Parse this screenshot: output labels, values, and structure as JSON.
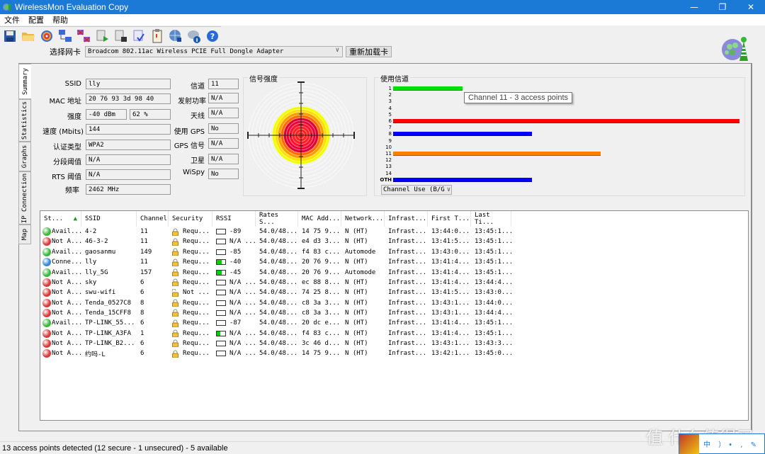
{
  "window": {
    "title": "WirelessMon Evaluation Copy",
    "controls": [
      "minimize",
      "restore",
      "close"
    ]
  },
  "menu": [
    "文件",
    "配置",
    "帮助"
  ],
  "toolbar": {
    "icons": [
      "save-icon",
      "open-folder-icon",
      "target-icon",
      "connect-icon",
      "disconnect-icon",
      "log-start-icon",
      "log-stop-icon",
      "report-icon",
      "clipboard-icon",
      "web-icon",
      "info-icon",
      "help-icon"
    ]
  },
  "adapter": {
    "label": "选择网卡",
    "selected": "Broadcom 802.11ac Wireless PCIE Full Dongle Adapter",
    "reload_label": "重新加载卡"
  },
  "tabs": [
    "Summary",
    "Statistics",
    "Graphs",
    "IP Connection",
    "Map"
  ],
  "active_tab": "Summary",
  "summary": {
    "left": [
      {
        "label": "SSID",
        "value": "lly"
      },
      {
        "label": "MAC 地址",
        "value": "20 76 93 3d 98 40"
      },
      {
        "label": "强度",
        "value": "-40 dBm",
        "value2": "62 %"
      },
      {
        "label": "速度 (Mbits)",
        "value": "144"
      },
      {
        "label": "认证类型",
        "value": "WPA2"
      },
      {
        "label": "分段阈值",
        "value": "N/A"
      },
      {
        "label": "RTS 阈值",
        "value": "N/A"
      },
      {
        "label": "频率",
        "value": "2462 MHz"
      }
    ],
    "right": [
      {
        "label": "信道",
        "value": "11"
      },
      {
        "label": "发射功率",
        "value": "N/A"
      },
      {
        "label": "天线",
        "value": "N/A"
      },
      {
        "label": "使用 GPS",
        "value": "No"
      },
      {
        "label": "GPS 信号",
        "value": "N/A"
      },
      {
        "label": "卫星",
        "value": "N/A"
      },
      {
        "label": "WiSpy",
        "value": "No"
      }
    ]
  },
  "signal": {
    "title": "信号强度",
    "percent": 62
  },
  "channel_use": {
    "title": "使用信道",
    "channels": [
      {
        "label": "1",
        "count": 1,
        "color": "#00e000"
      },
      {
        "label": "2",
        "count": 0,
        "color": ""
      },
      {
        "label": "3",
        "count": 0,
        "color": ""
      },
      {
        "label": "4",
        "count": 0,
        "color": ""
      },
      {
        "label": "5",
        "count": 0,
        "color": ""
      },
      {
        "label": "6",
        "count": 5,
        "color": "#ff0000"
      },
      {
        "label": "7",
        "count": 0,
        "color": ""
      },
      {
        "label": "8",
        "count": 2,
        "color": "#0000ff"
      },
      {
        "label": "9",
        "count": 0,
        "color": ""
      },
      {
        "label": "10",
        "count": 0,
        "color": ""
      },
      {
        "label": "11",
        "count": 3,
        "color": "#ff8000"
      },
      {
        "label": "12",
        "count": 0,
        "color": ""
      },
      {
        "label": "13",
        "count": 0,
        "color": ""
      },
      {
        "label": "14",
        "count": 0,
        "color": ""
      },
      {
        "label": "OTH",
        "count": 2,
        "color": "#0000ff"
      }
    ],
    "tooltip": "Channel 11 - 3 access points",
    "mode_select": "Channel Use (B/G"
  },
  "list": {
    "columns": [
      "St...",
      "SSID",
      "Channel",
      "Security",
      "RSSI",
      "Rates S...",
      "MAC Add...",
      "Network...",
      "Infrast...",
      "First T...",
      "Last Ti..."
    ],
    "rows": [
      {
        "status": "Avail...",
        "state": "available",
        "ssid": "4-2",
        "channel": "11",
        "security": "Requ...",
        "secure": true,
        "rssi": "-89",
        "rssi_level": 0,
        "rates": "54.0/48...",
        "mac": "14 75 9...",
        "network": "N (HT)",
        "infra": "Infrast...",
        "first": "13:44:0...",
        "last": "13:45:1..."
      },
      {
        "status": "Not A...",
        "state": "unavailable",
        "ssid": "46-3-2",
        "channel": "11",
        "security": "Requ...",
        "secure": true,
        "rssi": "N/A ...",
        "rssi_level": 0,
        "rates": "54.0/48...",
        "mac": "e4 d3 3...",
        "network": "N (HT)",
        "infra": "Infrast...",
        "first": "13:41:5...",
        "last": "13:45:1..."
      },
      {
        "status": "Avail...",
        "state": "available",
        "ssid": "gaosanmu",
        "channel": "149",
        "security": "Requ...",
        "secure": true,
        "rssi": "-85",
        "rssi_level": 0,
        "rates": "54.0/48...",
        "mac": "f4 83 c...",
        "network": "Automode",
        "infra": "Infrast...",
        "first": "13:43:0...",
        "last": "13:45:1..."
      },
      {
        "status": "Conne...",
        "state": "connected",
        "ssid": "lly",
        "channel": "11",
        "security": "Requ...",
        "secure": true,
        "rssi": "-40",
        "rssi_level": 0.6,
        "rates": "54.0/48...",
        "mac": "20 76 9...",
        "network": "N (HT)",
        "infra": "Infrast...",
        "first": "13:41:4...",
        "last": "13:45:1..."
      },
      {
        "status": "Avail...",
        "state": "available",
        "ssid": "lly_5G",
        "channel": "157",
        "security": "Requ...",
        "secure": true,
        "rssi": "-45",
        "rssi_level": 0.6,
        "rates": "54.0/48...",
        "mac": "20 76 9...",
        "network": "Automode",
        "infra": "Infrast...",
        "first": "13:41:4...",
        "last": "13:45:1..."
      },
      {
        "status": "Not A...",
        "state": "unavailable",
        "ssid": "sky",
        "channel": "6",
        "security": "Requ...",
        "secure": true,
        "rssi": "N/A ...",
        "rssi_level": 0,
        "rates": "54.0/48...",
        "mac": "ec 88 8...",
        "network": "N (HT)",
        "infra": "Infrast...",
        "first": "13:41:4...",
        "last": "13:44:4..."
      },
      {
        "status": "Not A...",
        "state": "unavailable",
        "ssid": "swu-wifi",
        "channel": "6",
        "security": "Not ...",
        "secure": false,
        "rssi": "N/A ...",
        "rssi_level": 0,
        "rates": "54.0/48...",
        "mac": "74 25 8...",
        "network": "N (HT)",
        "infra": "Infrast...",
        "first": "13:41:5...",
        "last": "13:43:0..."
      },
      {
        "status": "Not A...",
        "state": "unavailable",
        "ssid": "Tenda_0527C8",
        "channel": "8",
        "security": "Requ...",
        "secure": true,
        "rssi": "N/A ...",
        "rssi_level": 0,
        "rates": "54.0/48...",
        "mac": "c8 3a 3...",
        "network": "N (HT)",
        "infra": "Infrast...",
        "first": "13:43:1...",
        "last": "13:44:0..."
      },
      {
        "status": "Not A...",
        "state": "unavailable",
        "ssid": "Tenda_15CFF8",
        "channel": "8",
        "security": "Requ...",
        "secure": true,
        "rssi": "N/A ...",
        "rssi_level": 0,
        "rates": "54.0/48...",
        "mac": "c8 3a 3...",
        "network": "N (HT)",
        "infra": "Infrast...",
        "first": "13:43:1...",
        "last": "13:44:4..."
      },
      {
        "status": "Avail...",
        "state": "available",
        "ssid": "TP-LINK_55...",
        "channel": "6",
        "security": "Requ...",
        "secure": true,
        "rssi": "-87",
        "rssi_level": 0,
        "rates": "54.0/48...",
        "mac": "20 dc e...",
        "network": "N (HT)",
        "infra": "Infrast...",
        "first": "13:41:4...",
        "last": "13:45:1..."
      },
      {
        "status": "Not A...",
        "state": "unavailable",
        "ssid": "TP-LINK_A3FA",
        "channel": "1",
        "security": "Requ...",
        "secure": true,
        "rssi": "N/A ...",
        "rssi_level": 0.4,
        "rates": "54.0/48...",
        "mac": "f4 83 c...",
        "network": "N (HT)",
        "infra": "Infrast...",
        "first": "13:41:4...",
        "last": "13:45:1..."
      },
      {
        "status": "Not A...",
        "state": "unavailable",
        "ssid": "TP-LINK_B2...",
        "channel": "6",
        "security": "Requ...",
        "secure": true,
        "rssi": "N/A ...",
        "rssi_level": 0,
        "rates": "54.0/48...",
        "mac": "3c 46 d...",
        "network": "N (HT)",
        "infra": "Infrast...",
        "first": "13:43:1...",
        "last": "13:43:3..."
      },
      {
        "status": "Not A...",
        "state": "unavailable",
        "ssid": "约吗-L",
        "channel": "6",
        "security": "Requ...",
        "secure": true,
        "rssi": "N/A ...",
        "rssi_level": 0,
        "rates": "54.0/48...",
        "mac": "14 75 9...",
        "network": "N (HT)",
        "infra": "Infrast...",
        "first": "13:42:1...",
        "last": "13:45:0..."
      }
    ]
  },
  "status_colors": {
    "available": "#3cb83c",
    "unavailable": "#d83a3a",
    "connected": "#3a86d8"
  },
  "statusbar": {
    "text": "13 access points detected (12 secure - 1 unsecured) - 5 available"
  },
  "overlay": {
    "watermark": "值 什么值得买",
    "ime_text": "中 ）• , ✎"
  }
}
